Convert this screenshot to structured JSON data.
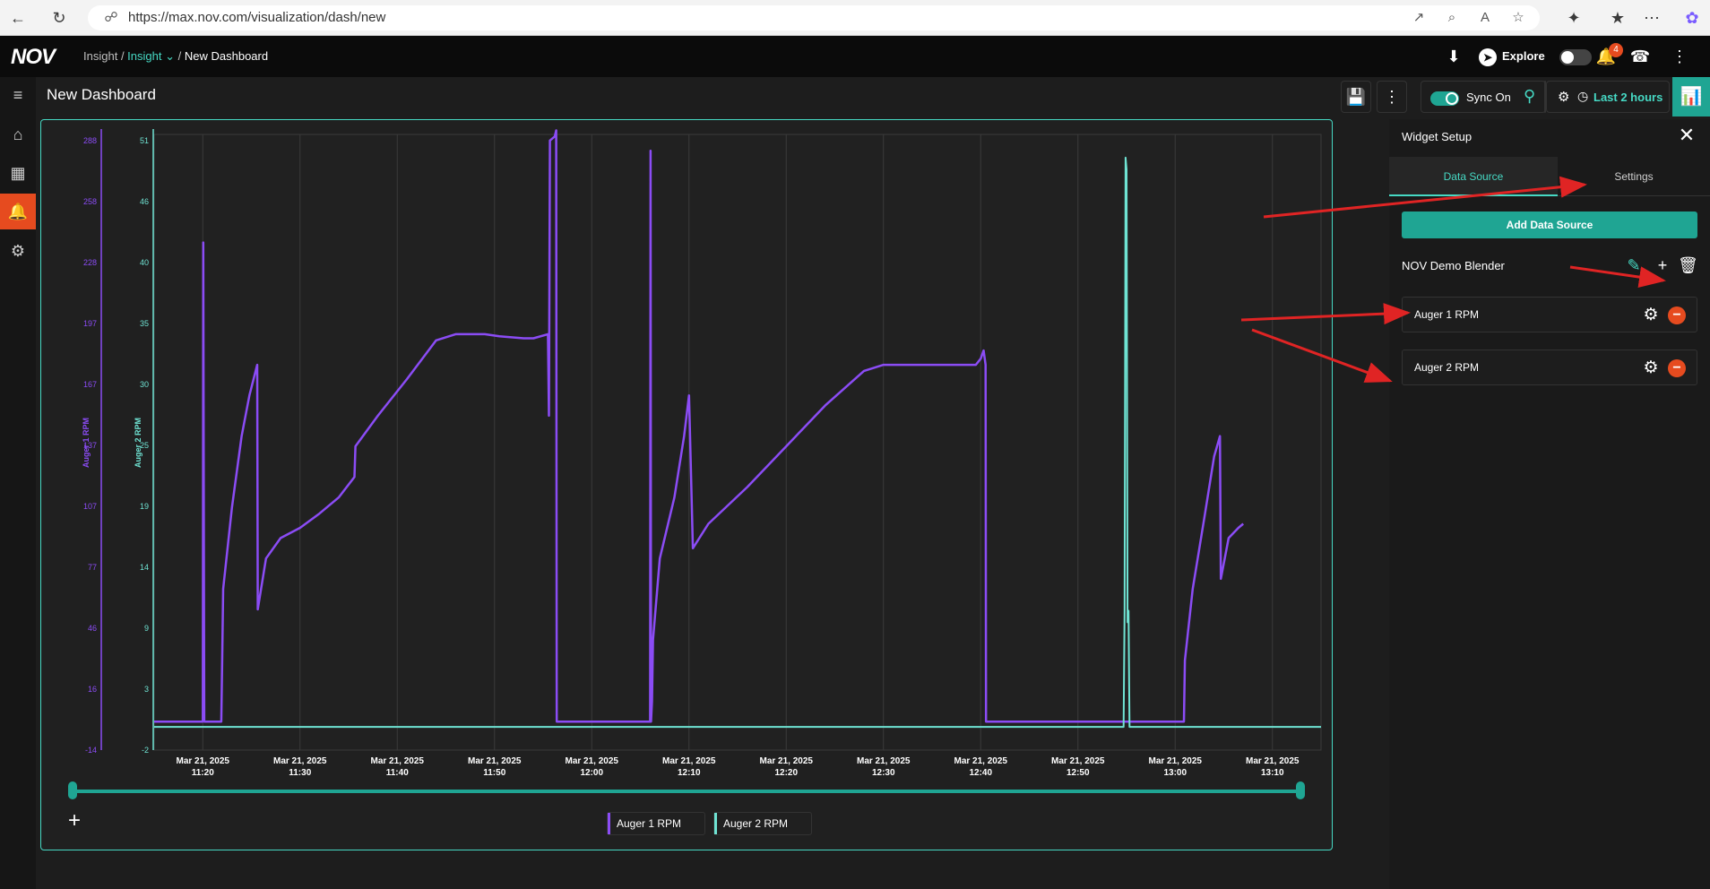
{
  "browser": {
    "url": "https://max.nov.com/visualization/dash/new"
  },
  "header": {
    "logo": "NOV",
    "breadcrumb": {
      "root": "Insight",
      "active": "Insight",
      "current": "New Dashboard"
    },
    "explore_label": "Explore",
    "notification_count": "4"
  },
  "toolbar": {
    "title": "New Dashboard",
    "sync_label": "Sync On",
    "time_range_label": "Last 2 hours"
  },
  "widget_panel": {
    "title": "Widget Setup",
    "tabs": [
      "Data Source",
      "Settings"
    ],
    "add_button": "Add Data Source",
    "source_name": "NOV Demo Blender",
    "series": [
      {
        "label": "Auger 1 RPM"
      },
      {
        "label": "Auger 2 RPM"
      }
    ]
  },
  "legend": [
    "Auger 1 RPM",
    "Auger 2 RPM"
  ],
  "colors": {
    "accent": "#1fa593",
    "series1": "#8b4cf5",
    "series2": "#6fe3d3",
    "alert": "#e64b1f",
    "annotation": "#e02424"
  },
  "chart_data": {
    "type": "line",
    "x_axis": {
      "ticks": [
        [
          "Mar 21, 2025",
          "11:20"
        ],
        [
          "Mar 21, 2025",
          "11:30"
        ],
        [
          "Mar 21, 2025",
          "11:40"
        ],
        [
          "Mar 21, 2025",
          "11:50"
        ],
        [
          "Mar 21, 2025",
          "12:00"
        ],
        [
          "Mar 21, 2025",
          "12:10"
        ],
        [
          "Mar 21, 2025",
          "12:20"
        ],
        [
          "Mar 21, 2025",
          "12:30"
        ],
        [
          "Mar 21, 2025",
          "12:40"
        ],
        [
          "Mar 21, 2025",
          "12:50"
        ],
        [
          "Mar 21, 2025",
          "13:00"
        ],
        [
          "Mar 21, 2025",
          "13:10"
        ]
      ],
      "range_minutes": [
        -5,
        115
      ]
    },
    "y_axes": [
      {
        "label": "Auger 1 RPM",
        "ticks": [
          288,
          258,
          228,
          197,
          167,
          137,
          107,
          77,
          46,
          16,
          -14
        ],
        "range": [
          -14,
          288
        ]
      },
      {
        "label": "Auger 2 RPM",
        "ticks": [
          51,
          46,
          40,
          35,
          30,
          25,
          19,
          14,
          9,
          3,
          -2
        ],
        "range": [
          -2,
          51
        ]
      }
    ],
    "series": [
      {
        "name": "Auger 1 RPM",
        "axis": 0,
        "minutes": [
          -5,
          0,
          0.05,
          0.15,
          0.2,
          1.9,
          2.0,
          2.1,
          3.0,
          4.0,
          4.8,
          5.6,
          5.65,
          6.5,
          8,
          10,
          12,
          14,
          15.6,
          15.7,
          18,
          21,
          24,
          26,
          27,
          29,
          30.5,
          33,
          34,
          35.5,
          35.6,
          35.7,
          36.2,
          36.35,
          36.4,
          46.0,
          46.05,
          46.1,
          46.2,
          46.3,
          47,
          48.5,
          49.5,
          50,
          50.4,
          52,
          56,
          60,
          64,
          68,
          70,
          72,
          75,
          78,
          79.5,
          80,
          80.3,
          80.5,
          80.55,
          80.6,
          100.9,
          101,
          101.8,
          103,
          104,
          104.6,
          104.7,
          105.5,
          106.5,
          107
        ],
        "values": [
          0,
          0,
          235,
          0,
          0,
          0,
          30,
          65,
          105,
          140,
          160,
          175,
          55,
          80,
          90,
          95,
          102,
          110,
          120,
          135,
          150,
          168,
          187,
          190,
          190,
          190,
          189,
          188,
          188,
          190,
          150,
          285,
          287,
          290,
          0,
          0,
          280,
          0,
          10,
          40,
          80,
          110,
          140,
          160,
          85,
          97,
          115,
          135,
          155,
          172,
          175,
          175,
          175,
          175,
          175,
          178,
          182,
          175,
          0,
          0,
          0,
          30,
          65,
          100,
          130,
          140,
          70,
          90,
          95,
          97
        ]
      },
      {
        "name": "Auger 2 RPM",
        "axis": 1,
        "minutes": [
          -5,
          94.7,
          94.8,
          94.9,
          95.0,
          95.1,
          95.2,
          95.3,
          95.5,
          115
        ],
        "values": [
          0,
          0,
          10,
          49,
          48,
          9,
          10,
          0,
          0,
          0
        ]
      }
    ]
  }
}
